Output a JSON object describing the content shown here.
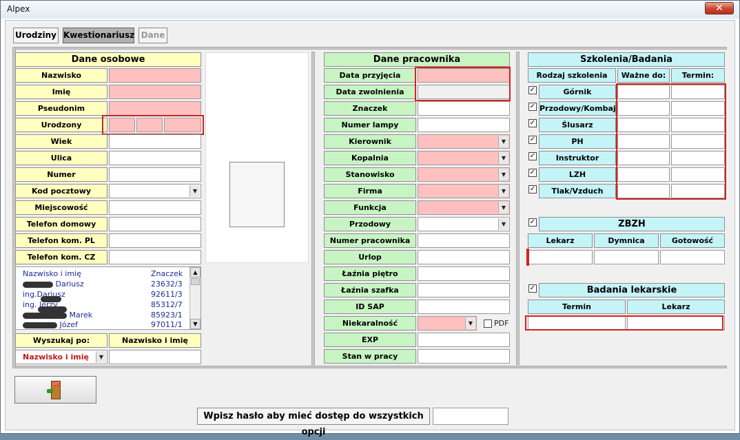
{
  "window": {
    "title": "Alpex",
    "close_label": "✕"
  },
  "tabs": [
    "Urodziny",
    "Kwestionariusz",
    "Dane"
  ],
  "personal": {
    "header": "Dane osobowe",
    "labels": [
      "Nazwisko",
      "Imię",
      "Pseudonim",
      "Urodzony",
      "Wiek",
      "Ulica",
      "Numer",
      "Kod pocztowy",
      "Miejscowość",
      "Telefon domowy",
      "Telefon kom. PL",
      "Telefon kom. CZ"
    ],
    "list_header": {
      "name": "Nazwisko i imię",
      "code": "Znaczek"
    },
    "list_rows": [
      {
        "name": "Dariusz",
        "code": "23632/3"
      },
      {
        "name": "ing.Dariusz",
        "code": "92611/3"
      },
      {
        "name": "ing. Jerzy",
        "code": "85312/7"
      },
      {
        "name": "Marek",
        "code": "85923/1"
      },
      {
        "name": "Józef",
        "code": "97011/1"
      }
    ],
    "search_label": "Wyszukaj po:",
    "search_mode_label": "Nazwisko i imię",
    "search_mode_value": "Nazwisko i imię"
  },
  "employee": {
    "header": "Dane pracownika",
    "labels": [
      "Data przyjęcia",
      "Data zwolnienia",
      "Znaczek",
      "Numer lampy",
      "Kierownik",
      "Kopalnia",
      "Stanowisko",
      "Firma",
      "Funkcja",
      "Przodowy",
      "Numer pracownika",
      "Urlop",
      "Łaźnia piętro",
      "Łaźnia szafka",
      "ID SAP",
      "Niekaralność",
      "EXP",
      "Stan w pracy"
    ],
    "pdf_label": "PDF"
  },
  "training": {
    "header": "Szkolenia/Badania",
    "col_headers": [
      "Rodzaj szkolenia",
      "Ważne do:",
      "Termin:"
    ],
    "items": [
      "Górnik",
      "Przodowy/Kombaj",
      "Ślusarz",
      "PH",
      "Instruktor",
      "LZH",
      "Tlak/Vzduch"
    ]
  },
  "zbzh": {
    "header": "ZBZH",
    "col_headers": [
      "Lekarz",
      "Dymnica",
      "Gotowość"
    ]
  },
  "medical": {
    "header": "Badania lekarskie",
    "col_headers": [
      "Termin",
      "Lekarz"
    ]
  },
  "password": {
    "label": "Wpisz hasło aby mieć dostęp do wszystkich opcji"
  },
  "exit_button": {
    "icon": "exit-door-icon",
    "icon_text": "EXIT"
  }
}
